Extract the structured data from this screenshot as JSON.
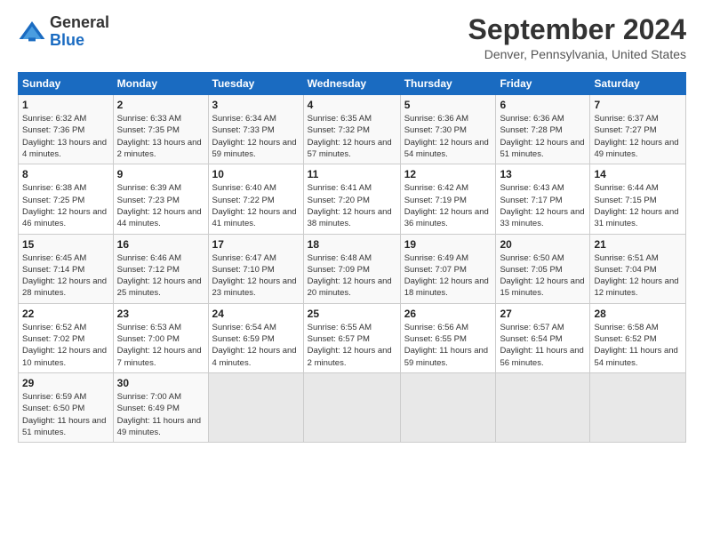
{
  "header": {
    "logo_general": "General",
    "logo_blue": "Blue",
    "month_title": "September 2024",
    "location": "Denver, Pennsylvania, United States"
  },
  "days_of_week": [
    "Sunday",
    "Monday",
    "Tuesday",
    "Wednesday",
    "Thursday",
    "Friday",
    "Saturday"
  ],
  "weeks": [
    [
      {
        "day": "1",
        "sunrise": "6:32 AM",
        "sunset": "7:36 PM",
        "daylight": "13 hours and 4 minutes."
      },
      {
        "day": "2",
        "sunrise": "6:33 AM",
        "sunset": "7:35 PM",
        "daylight": "13 hours and 2 minutes."
      },
      {
        "day": "3",
        "sunrise": "6:34 AM",
        "sunset": "7:33 PM",
        "daylight": "12 hours and 59 minutes."
      },
      {
        "day": "4",
        "sunrise": "6:35 AM",
        "sunset": "7:32 PM",
        "daylight": "12 hours and 57 minutes."
      },
      {
        "day": "5",
        "sunrise": "6:36 AM",
        "sunset": "7:30 PM",
        "daylight": "12 hours and 54 minutes."
      },
      {
        "day": "6",
        "sunrise": "6:36 AM",
        "sunset": "7:28 PM",
        "daylight": "12 hours and 51 minutes."
      },
      {
        "day": "7",
        "sunrise": "6:37 AM",
        "sunset": "7:27 PM",
        "daylight": "12 hours and 49 minutes."
      }
    ],
    [
      {
        "day": "8",
        "sunrise": "6:38 AM",
        "sunset": "7:25 PM",
        "daylight": "12 hours and 46 minutes."
      },
      {
        "day": "9",
        "sunrise": "6:39 AM",
        "sunset": "7:23 PM",
        "daylight": "12 hours and 44 minutes."
      },
      {
        "day": "10",
        "sunrise": "6:40 AM",
        "sunset": "7:22 PM",
        "daylight": "12 hours and 41 minutes."
      },
      {
        "day": "11",
        "sunrise": "6:41 AM",
        "sunset": "7:20 PM",
        "daylight": "12 hours and 38 minutes."
      },
      {
        "day": "12",
        "sunrise": "6:42 AM",
        "sunset": "7:19 PM",
        "daylight": "12 hours and 36 minutes."
      },
      {
        "day": "13",
        "sunrise": "6:43 AM",
        "sunset": "7:17 PM",
        "daylight": "12 hours and 33 minutes."
      },
      {
        "day": "14",
        "sunrise": "6:44 AM",
        "sunset": "7:15 PM",
        "daylight": "12 hours and 31 minutes."
      }
    ],
    [
      {
        "day": "15",
        "sunrise": "6:45 AM",
        "sunset": "7:14 PM",
        "daylight": "12 hours and 28 minutes."
      },
      {
        "day": "16",
        "sunrise": "6:46 AM",
        "sunset": "7:12 PM",
        "daylight": "12 hours and 25 minutes."
      },
      {
        "day": "17",
        "sunrise": "6:47 AM",
        "sunset": "7:10 PM",
        "daylight": "12 hours and 23 minutes."
      },
      {
        "day": "18",
        "sunrise": "6:48 AM",
        "sunset": "7:09 PM",
        "daylight": "12 hours and 20 minutes."
      },
      {
        "day": "19",
        "sunrise": "6:49 AM",
        "sunset": "7:07 PM",
        "daylight": "12 hours and 18 minutes."
      },
      {
        "day": "20",
        "sunrise": "6:50 AM",
        "sunset": "7:05 PM",
        "daylight": "12 hours and 15 minutes."
      },
      {
        "day": "21",
        "sunrise": "6:51 AM",
        "sunset": "7:04 PM",
        "daylight": "12 hours and 12 minutes."
      }
    ],
    [
      {
        "day": "22",
        "sunrise": "6:52 AM",
        "sunset": "7:02 PM",
        "daylight": "12 hours and 10 minutes."
      },
      {
        "day": "23",
        "sunrise": "6:53 AM",
        "sunset": "7:00 PM",
        "daylight": "12 hours and 7 minutes."
      },
      {
        "day": "24",
        "sunrise": "6:54 AM",
        "sunset": "6:59 PM",
        "daylight": "12 hours and 4 minutes."
      },
      {
        "day": "25",
        "sunrise": "6:55 AM",
        "sunset": "6:57 PM",
        "daylight": "12 hours and 2 minutes."
      },
      {
        "day": "26",
        "sunrise": "6:56 AM",
        "sunset": "6:55 PM",
        "daylight": "11 hours and 59 minutes."
      },
      {
        "day": "27",
        "sunrise": "6:57 AM",
        "sunset": "6:54 PM",
        "daylight": "11 hours and 56 minutes."
      },
      {
        "day": "28",
        "sunrise": "6:58 AM",
        "sunset": "6:52 PM",
        "daylight": "11 hours and 54 minutes."
      }
    ],
    [
      {
        "day": "29",
        "sunrise": "6:59 AM",
        "sunset": "6:50 PM",
        "daylight": "11 hours and 51 minutes."
      },
      {
        "day": "30",
        "sunrise": "7:00 AM",
        "sunset": "6:49 PM",
        "daylight": "11 hours and 49 minutes."
      },
      null,
      null,
      null,
      null,
      null
    ]
  ],
  "labels": {
    "sunrise": "Sunrise:",
    "sunset": "Sunset:",
    "daylight": "Daylight:"
  }
}
